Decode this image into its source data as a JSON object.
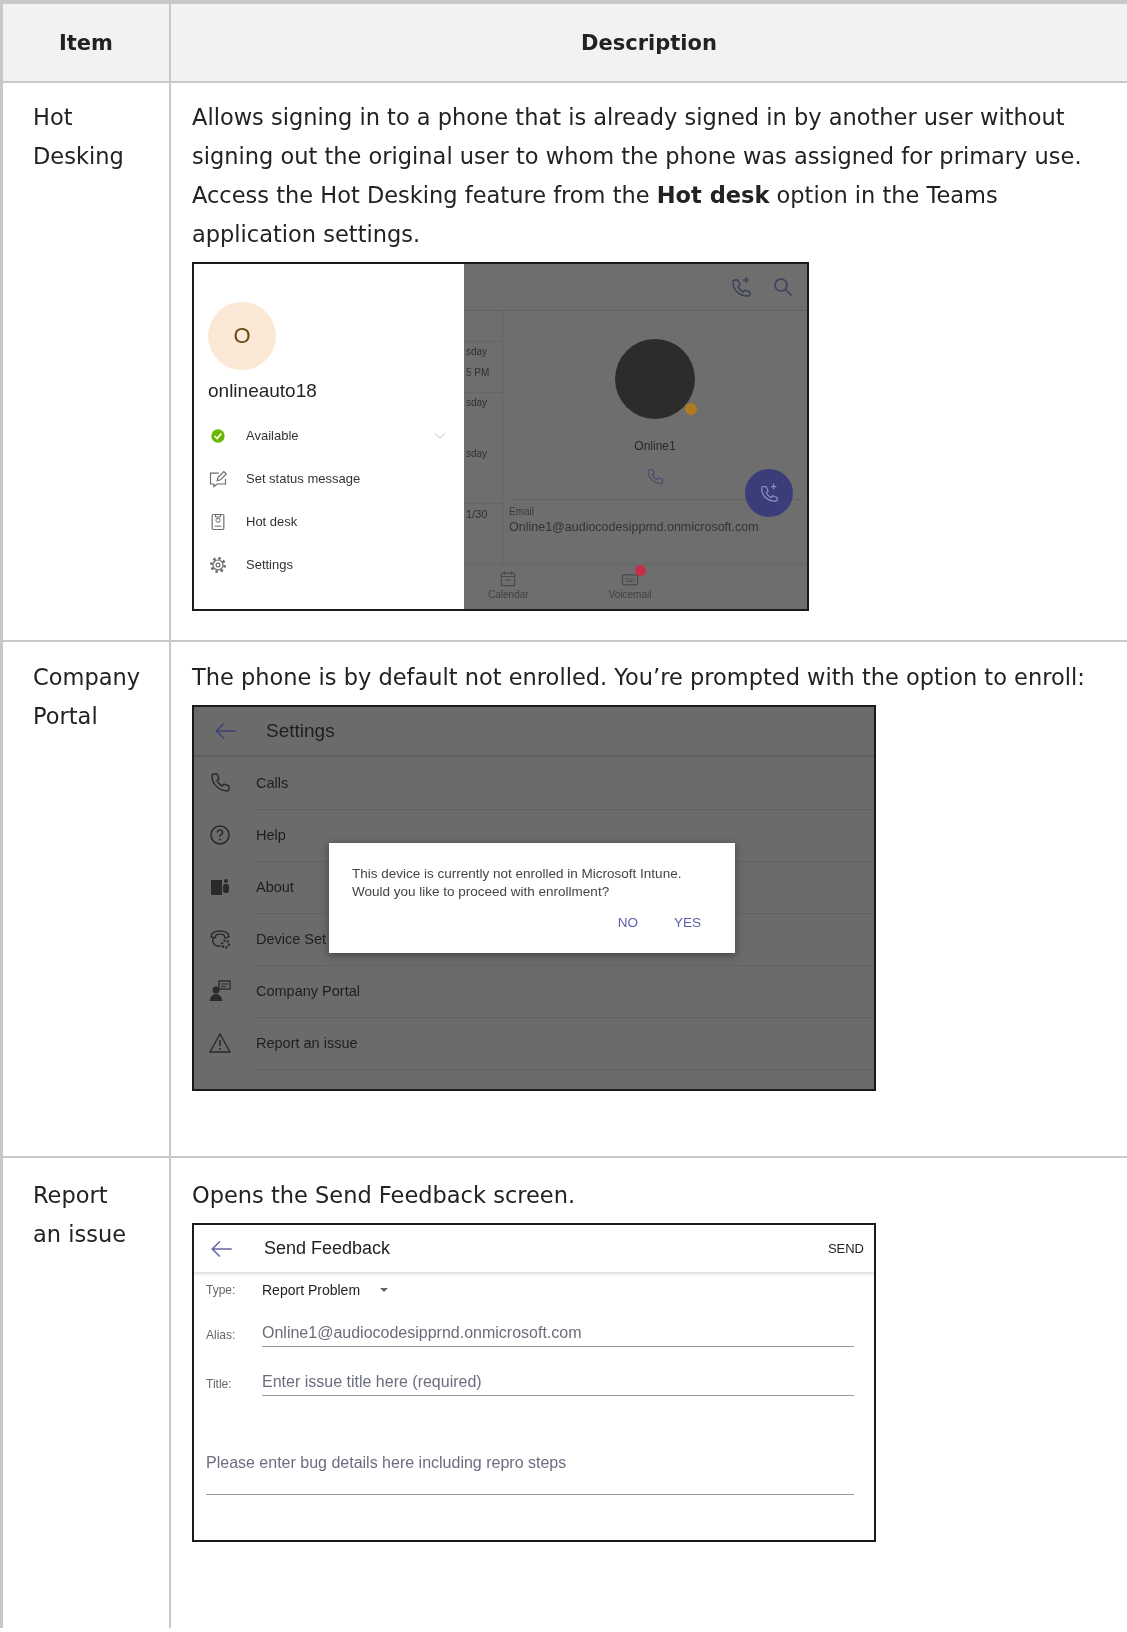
{
  "table": {
    "columns": [
      "Item",
      "Description"
    ],
    "rows": [
      {
        "item": "Hot Desking",
        "description": "Allows signing in to a phone that is already signed in by another user without signing out the original user to whom the phone was assigned for primary use. Access the Hot Desking feature from the **Hot desk** option in the Teams application settings.",
        "screenshot": {
          "kind": "profile_menu",
          "avatar_initial": "O",
          "user_name": "onlineauto18",
          "menu": [
            {
              "label": "Available",
              "expandable": true
            },
            {
              "label": "Set status message",
              "expandable": false
            },
            {
              "label": "Hot desk",
              "expandable": false
            },
            {
              "label": "Settings",
              "expandable": false
            }
          ],
          "background": {
            "list_fragments": [
              "sday",
              "5 PM",
              "sday",
              "sday",
              "1/30"
            ],
            "contact_name": "Online1",
            "email_label": "Email",
            "email": "Online1@audiocodesipprnd.onmicrosoft.com",
            "tabs": [
              {
                "label": "Calendar",
                "badge": false
              },
              {
                "label": "Voicemail",
                "badge": true
              }
            ]
          }
        }
      },
      {
        "item": "Company Portal",
        "description": "The phone is by default not enrolled. You’re prompted with the option to enroll:",
        "screenshot": {
          "kind": "settings_dialog",
          "title": "Settings",
          "items": [
            "Calls",
            "Help",
            "About",
            "Device Set",
            "Company Portal",
            "Report an issue"
          ],
          "dialog": {
            "message": "This device is currently not enrolled in Microsoft Intune. Would you like to proceed with enrollment?",
            "buttons": [
              "NO",
              "YES"
            ]
          }
        }
      },
      {
        "item": "Report an issue",
        "description": "Opens the Send Feedback screen.",
        "screenshot": {
          "kind": "feedback_form",
          "title": "Send Feedback",
          "action": "SEND",
          "fields": [
            {
              "kind": "dropdown",
              "label": "Type:",
              "value": "Report Problem"
            },
            {
              "kind": "text",
              "label": "Alias:",
              "value": "Online1@audiocodesipprnd.onmicrosoft.com"
            },
            {
              "kind": "text",
              "label": "Title:",
              "placeholder": "Enter issue title here (required)"
            },
            {
              "kind": "textarea",
              "placeholder": "Please enter bug details here including repro steps"
            }
          ]
        }
      }
    ]
  }
}
